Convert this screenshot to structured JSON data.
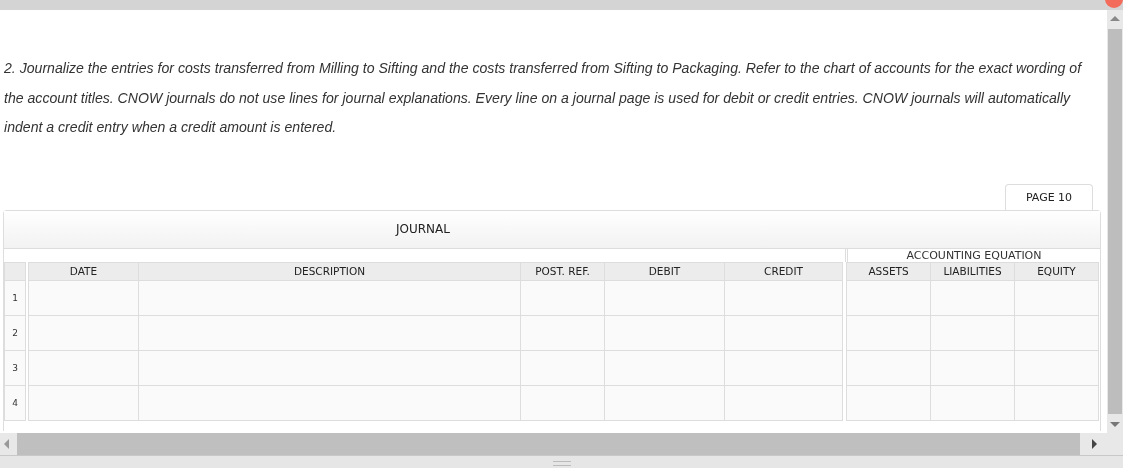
{
  "instructions": "2. Journalize the entries for costs transferred from Milling to Sifting and the costs transferred from Sifting to Packaging. Refer to the chart of accounts for the exact wording of the account titles. CNOW journals do not use lines for journal explanations. Every line on a journal page is used for debit or credit entries. CNOW journals will automatically indent a credit entry when a credit amount is entered.",
  "page_tab": "PAGE 10",
  "journal": {
    "title": "JOURNAL",
    "group_label": "ACCOUNTING EQUATION",
    "columns": [
      "DATE",
      "DESCRIPTION",
      "POST. REF.",
      "DEBIT",
      "CREDIT"
    ],
    "equation_columns": [
      "ASSETS",
      "LIABILITIES",
      "EQUITY"
    ],
    "rows": [
      {
        "number": "1"
      },
      {
        "number": "2"
      },
      {
        "number": "3"
      },
      {
        "number": "4"
      }
    ]
  }
}
